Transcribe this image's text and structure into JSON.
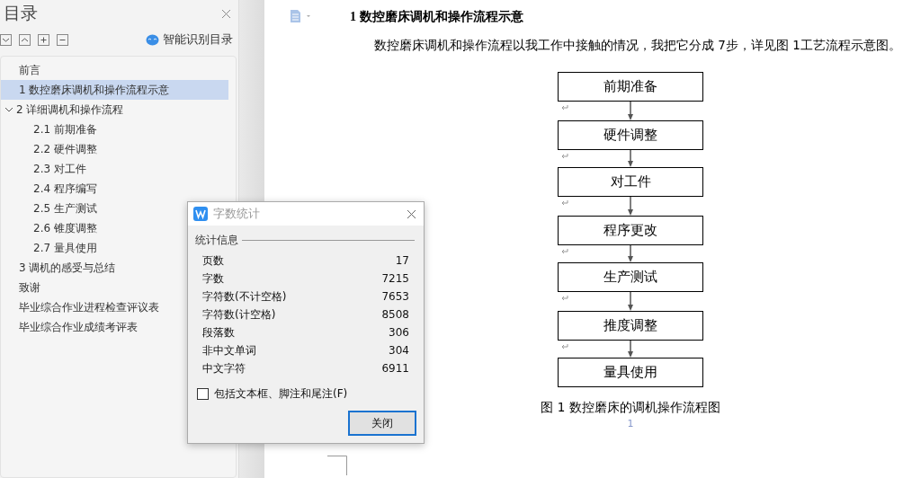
{
  "outline_panel": {
    "title": "目录",
    "smart_button": "智能识别目录",
    "items": [
      {
        "label": "前言",
        "selected": false
      },
      {
        "label": "1 数控磨床调机和操作流程示意",
        "selected": true
      },
      {
        "label": "2  详细调机和操作流程",
        "selected": false,
        "expanded": true,
        "children": [
          {
            "label": "2.1 前期准备",
            "selected": false
          },
          {
            "label": "2.2 硬件调整",
            "selected": false
          },
          {
            "label": "2.3 对工件",
            "selected": false
          },
          {
            "label": "2.4 程序编写",
            "selected": false
          },
          {
            "label": "2.5 生产测试",
            "selected": false
          },
          {
            "label": "2.6 锥度调整",
            "selected": false
          },
          {
            "label": "2.7 量具使用",
            "selected": false
          }
        ]
      },
      {
        "label": "3  调机的感受与总结",
        "selected": false
      },
      {
        "label": "致谢",
        "selected": false
      },
      {
        "label": "毕业综合作业进程检查评议表",
        "selected": false
      },
      {
        "label": "毕业综合作业成绩考评表",
        "selected": false
      }
    ]
  },
  "document": {
    "heading": "1 数控磨床调机和操作流程示意",
    "paragraph": "数控磨床调机和操作流程以我工作中接触的情况，我把它分成 7步，详见图 1工艺流程示意图。",
    "flowchart": {
      "steps": [
        "前期准备",
        "硬件调整",
        "对工件",
        "程序更改",
        "生产测试",
        "推度调整",
        "量具使用"
      ],
      "caption": "图 1  数控磨床的调机操作流程图"
    },
    "page_number": "1"
  },
  "word_count_dialog": {
    "title": "字数统计",
    "section": "统计信息",
    "stats": [
      {
        "label": "页数",
        "value": "17"
      },
      {
        "label": "字数",
        "value": "7215"
      },
      {
        "label": "字符数(不计空格)",
        "value": "7653"
      },
      {
        "label": "字符数(计空格)",
        "value": "8508"
      },
      {
        "label": "段落数",
        "value": "306"
      },
      {
        "label": "非中文单词",
        "value": "304"
      },
      {
        "label": "中文字符",
        "value": "6911"
      }
    ],
    "include_option": {
      "label": "包括文本框、脚注和尾注(F)",
      "checked": false
    },
    "close_button": "关闭"
  }
}
